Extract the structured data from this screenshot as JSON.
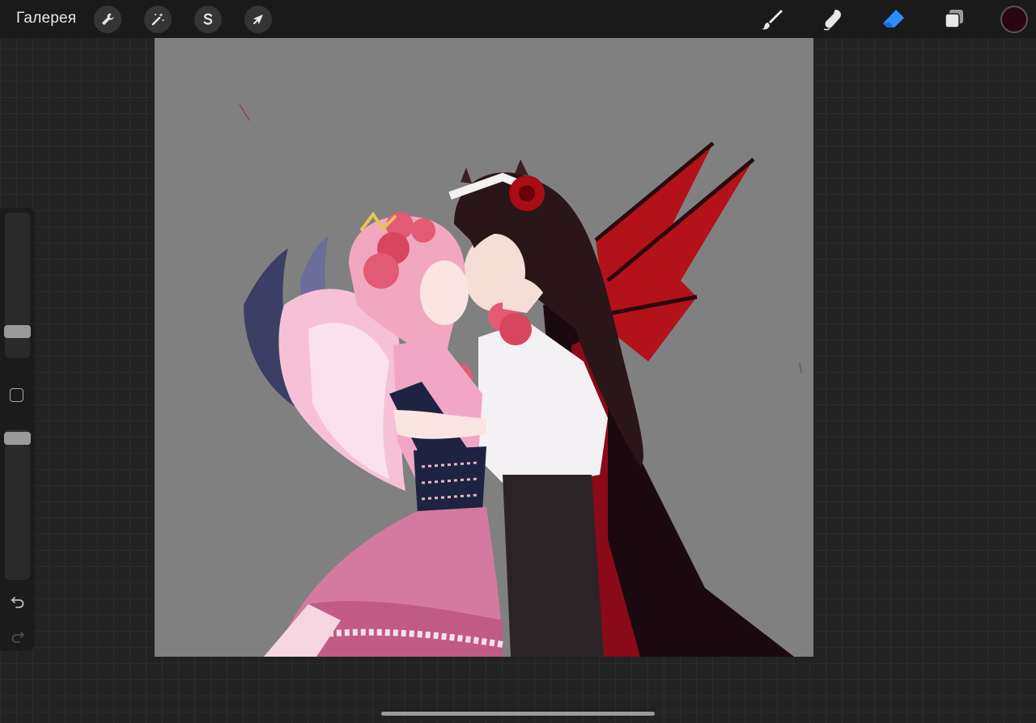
{
  "toolbar": {
    "gallery_label": "Галерея",
    "left_tools": [
      {
        "name": "actions",
        "icon": "wrench-icon"
      },
      {
        "name": "adjustments",
        "icon": "magic-wand-icon"
      },
      {
        "name": "selection",
        "icon": "selection-s-icon"
      },
      {
        "name": "transform",
        "icon": "arrow-cursor-icon"
      }
    ],
    "right_tools": [
      {
        "name": "brush",
        "icon": "brush-icon",
        "active": false
      },
      {
        "name": "smudge",
        "icon": "smudge-finger-icon",
        "active": false
      },
      {
        "name": "eraser",
        "icon": "eraser-icon",
        "active": true
      },
      {
        "name": "layers",
        "icon": "layers-icon",
        "active": false
      }
    ],
    "current_color": "#2a0612"
  },
  "colors": {
    "active_tool": "#2d8cff",
    "canvas_background": "#808080"
  },
  "sidebar": {
    "brush_size_level": 0.85,
    "opacity_level": 0.02,
    "modify_button": "square-modify-icon",
    "undo": "undo-icon",
    "redo": "redo-icon"
  },
  "artwork": {
    "description_icon": "illustration-angel-and-vampire-couple"
  }
}
